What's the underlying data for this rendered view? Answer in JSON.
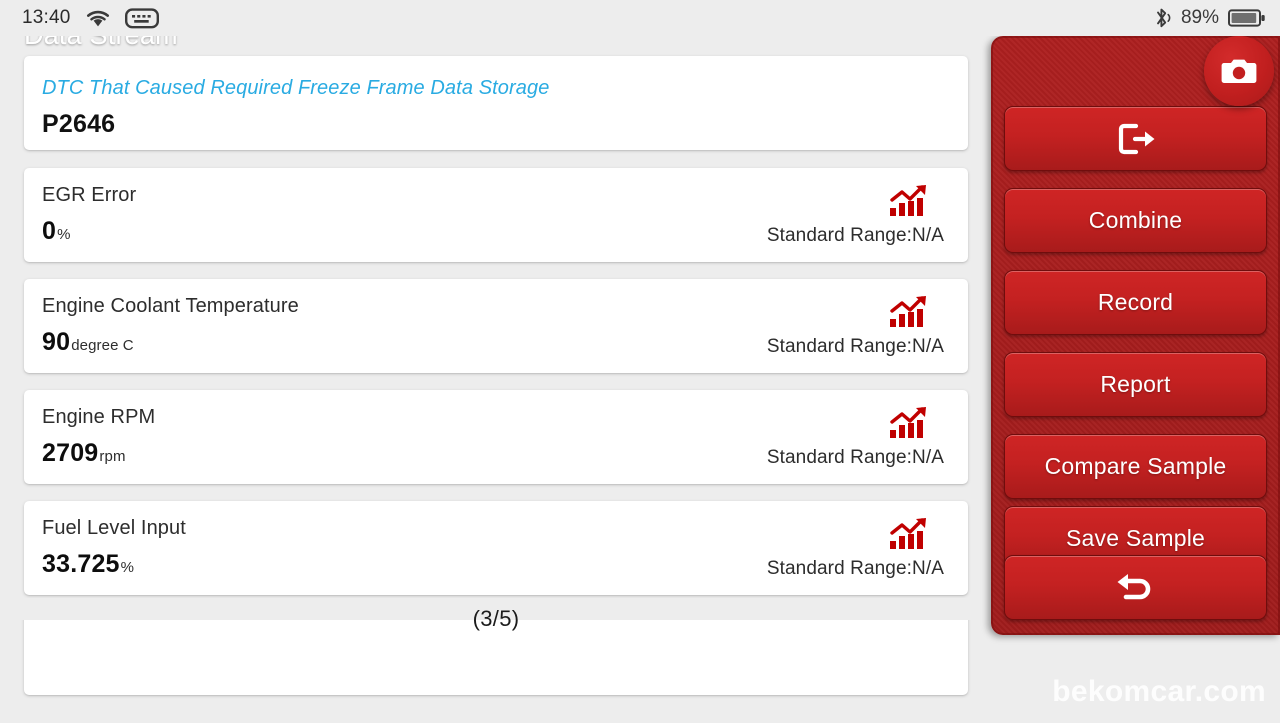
{
  "statusbar": {
    "time": "13:40",
    "battery_percent": "89%",
    "icons": [
      "wifi-icon",
      "keyboard-icon",
      "bluetooth-icon",
      "battery-icon"
    ]
  },
  "dtc_card": {
    "label": "DTC That Caused Required Freeze Frame Data Storage",
    "value": "P2646",
    "label_color": "#29abe2"
  },
  "items": [
    {
      "name": "EGR Error",
      "value": "0",
      "unit": "%",
      "range": "Standard Range:N/A",
      "icon": "bar-chart-icon"
    },
    {
      "name": "Engine Coolant Temperature",
      "value": "90",
      "unit": "degree C",
      "range": "Standard Range:N/A",
      "icon": "bar-chart-icon"
    },
    {
      "name": "Engine RPM",
      "value": "2709",
      "unit": "rpm",
      "range": "Standard Range:N/A",
      "icon": "bar-chart-icon"
    },
    {
      "name": "Fuel Level Input",
      "value": "33.725",
      "unit": "%",
      "range": "Standard Range:N/A",
      "icon": "bar-chart-icon"
    }
  ],
  "pager": "(3/5)",
  "panel": {
    "title": "Data Stream",
    "accent_color": "#c42121",
    "camera_button": "camera-icon",
    "buttons": [
      {
        "label": "",
        "icon": "exit-icon"
      },
      {
        "label": "Combine",
        "icon": ""
      },
      {
        "label": "Record",
        "icon": ""
      },
      {
        "label": "Report",
        "icon": ""
      },
      {
        "label": "Compare Sample",
        "icon": ""
      },
      {
        "label": "Save Sample",
        "icon": ""
      },
      {
        "label": "",
        "icon": "back-arrow-icon"
      }
    ]
  },
  "watermark": "bekomcar.com"
}
